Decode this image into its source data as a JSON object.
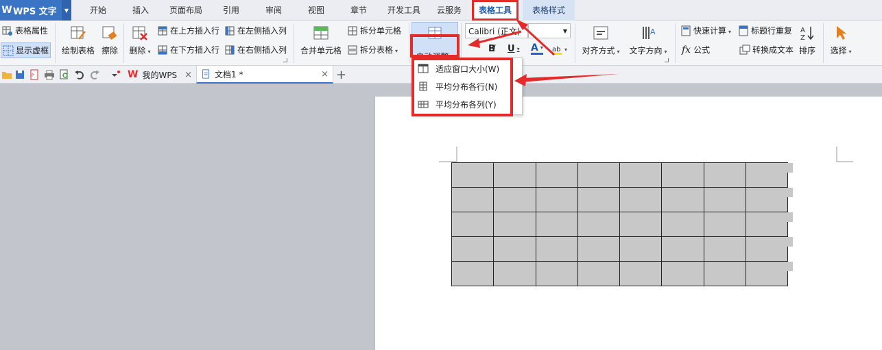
{
  "app": {
    "name": "WPS 文字"
  },
  "menu_tabs": [
    "开始",
    "插入",
    "页面布局",
    "引用",
    "审阅",
    "视图",
    "章节",
    "开发工具",
    "云服务",
    "表格工具",
    "表格样式"
  ],
  "ribbon": {
    "table_props": "表格属性",
    "show_grid": "显示虚框",
    "draw_table": "绘制表格",
    "erase": "擦除",
    "delete": "删除",
    "insert_above": "在上方插入行",
    "insert_below": "在下方插入行",
    "insert_left": "在左侧插入列",
    "insert_right": "在右侧插入列",
    "merge_cells": "合并单元格",
    "split_cells": "拆分单元格",
    "split_table": "拆分表格",
    "auto_fit": "自动调整",
    "font_name": "Calibri (正文)",
    "font_size": "",
    "bold": "B",
    "italic": "I",
    "underline": "U",
    "font_color": "A",
    "align": "对齐方式",
    "text_dir": "文字方向",
    "quick_calc": "快速计算",
    "formula": "公式",
    "formula_fx": "fx",
    "header_repeat": "标题行重复",
    "to_text": "转换成文本",
    "sort": "排序",
    "select": "选择"
  },
  "doc_tabs": [
    {
      "label": "我的WPS",
      "icon": "wps-logo-icon"
    },
    {
      "label": "文档1 *",
      "icon": "document-icon"
    }
  ],
  "dropdown": [
    {
      "label": "适应窗口大小(W)"
    },
    {
      "label": "平均分布各行(N)"
    },
    {
      "label": "平均分布各列(Y)"
    }
  ],
  "table": {
    "rows": 5,
    "cols": 8
  },
  "colors": {
    "accent": "#3a74c4",
    "annotation": "#e52a2a",
    "cell_fill": "#c8c8c8"
  }
}
